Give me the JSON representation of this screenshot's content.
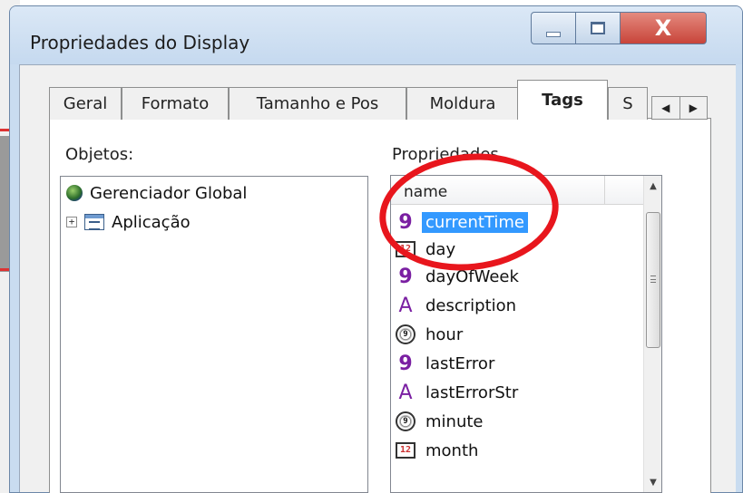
{
  "window": {
    "title": "Propriedades do Display",
    "controls": {
      "minimize": "minimize",
      "maximize": "maximize",
      "close": "X"
    }
  },
  "tabs": [
    {
      "label": "Geral",
      "active": false
    },
    {
      "label": "Formato",
      "active": false
    },
    {
      "label": "Tamanho e Pos",
      "active": false
    },
    {
      "label": "Moldura",
      "active": false
    },
    {
      "label": "Tags",
      "active": true
    },
    {
      "label": "S",
      "active": false
    }
  ],
  "tab_scroll": {
    "left": "◀",
    "right": "▶"
  },
  "objects": {
    "label": "Objetos:",
    "items": [
      {
        "label": "Gerenciador Global",
        "icon": "globe-icon"
      },
      {
        "label": "Aplicação",
        "icon": "application-icon",
        "expander": "+"
      }
    ]
  },
  "properties": {
    "label": "Propriedades",
    "header": "name",
    "items": [
      {
        "label": "currentTime",
        "icon": "integer-icon",
        "glyph": "9",
        "selected": true
      },
      {
        "label": "day",
        "icon": "date-icon",
        "glyph": "12",
        "selected": false
      },
      {
        "label": "dayOfWeek",
        "icon": "integer-icon",
        "glyph": "9",
        "selected": false
      },
      {
        "label": "description",
        "icon": "string-icon",
        "glyph": "A",
        "selected": false
      },
      {
        "label": "hour",
        "icon": "clock-icon",
        "glyph": "9",
        "selected": false
      },
      {
        "label": "lastError",
        "icon": "integer-icon",
        "glyph": "9",
        "selected": false
      },
      {
        "label": "lastErrorStr",
        "icon": "string-icon",
        "glyph": "A",
        "selected": false
      },
      {
        "label": "minute",
        "icon": "clock-icon",
        "glyph": "9",
        "selected": false
      },
      {
        "label": "month",
        "icon": "date-icon",
        "glyph": "12",
        "selected": false
      }
    ]
  },
  "scrollbar": {
    "up": "▲",
    "down": "▼",
    "position": 0.0
  },
  "colors": {
    "annotation": "#e8161d",
    "selection": "#3399ff",
    "tag_glyph": "#7a1fa2"
  }
}
